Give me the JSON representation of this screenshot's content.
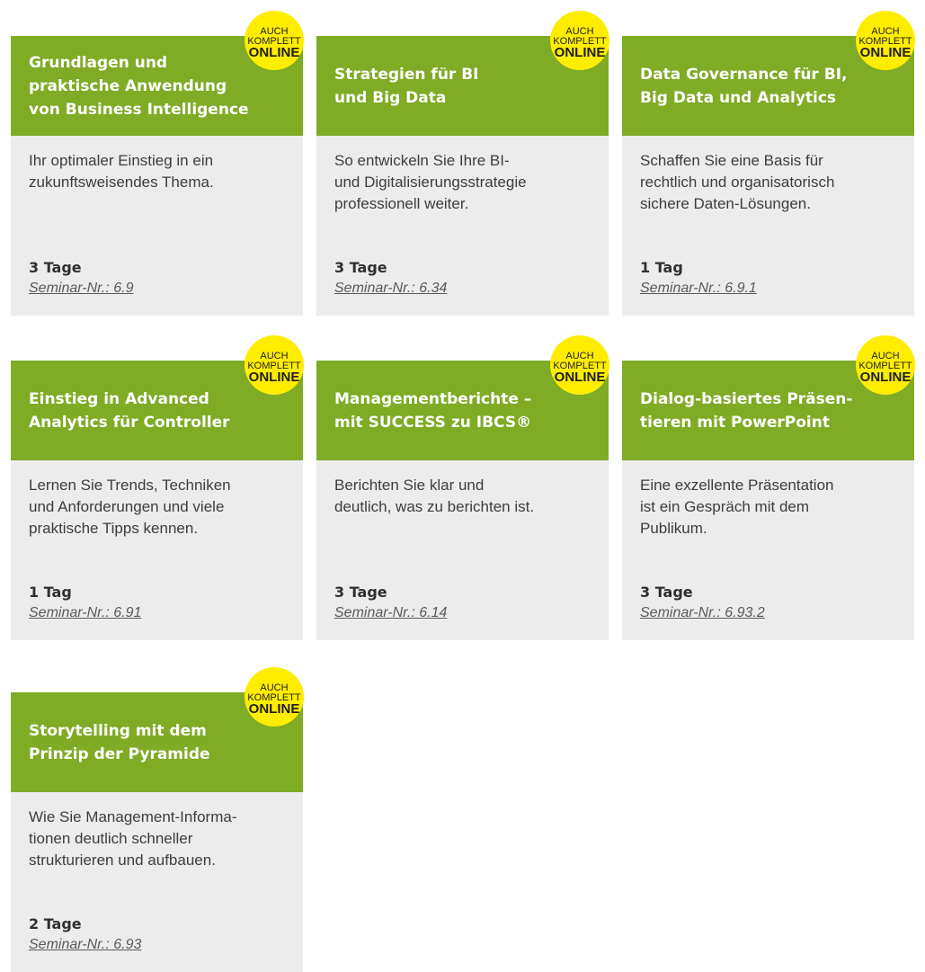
{
  "badge": {
    "line1": "AUCH",
    "line2": "KOMPLETT",
    "line3": "ONLINE"
  },
  "colors": {
    "header_green": "#7fab25",
    "card_gray": "#ececec",
    "badge_yellow": "#ffed00"
  },
  "cards": [
    {
      "title_lines": [
        "Grundlagen und",
        "praktische Anwendung",
        "von Business Intelligence"
      ],
      "desc_lines": [
        "Ihr optimaler Einstieg in ein",
        "zukunftsweisendes Thema."
      ],
      "duration": "3 Tage",
      "seminar": "Seminar-Nr.: 6.9"
    },
    {
      "title_lines": [
        "Strategien für BI",
        "und Big Data"
      ],
      "desc_lines": [
        "So entwickeln Sie Ihre BI-",
        "und Digitalisierungsstrategie",
        "professionell weiter."
      ],
      "duration": "3 Tage",
      "seminar": "Seminar-Nr.: 6.34"
    },
    {
      "title_lines": [
        "Data Governance für BI,",
        "Big Data und Analytics"
      ],
      "desc_lines": [
        "Schaffen Sie eine Basis für",
        "rechtlich und organisatorisch",
        "sichere Daten-Lösungen."
      ],
      "duration": "1 Tag",
      "seminar": "Seminar-Nr.: 6.9.1"
    },
    {
      "title_lines": [
        "Einstieg in Advanced",
        "Analytics für Controller"
      ],
      "desc_lines": [
        "Lernen Sie Trends, Techniken",
        "und Anforderungen und viele",
        "praktische Tipps kennen."
      ],
      "duration": "1 Tag",
      "seminar": "Seminar-Nr.: 6.91"
    },
    {
      "title_lines": [
        "Managementberichte –",
        "mit SUCCESS zu IBCS®"
      ],
      "desc_lines": [
        "Berichten Sie klar und",
        "deutlich, was zu berichten ist."
      ],
      "duration": "3 Tage",
      "seminar": "Seminar-Nr.: 6.14"
    },
    {
      "title_lines": [
        "Dialog-basiertes Präsen-",
        "tieren mit PowerPoint"
      ],
      "desc_lines": [
        "Eine exzellente Präsentation",
        "ist ein Gespräch mit dem",
        "Publikum."
      ],
      "duration": "3 Tage",
      "seminar": "Seminar-Nr.: 6.93.2"
    },
    {
      "title_lines": [
        "Storytelling mit dem",
        "Prinzip der Pyramide"
      ],
      "desc_lines": [
        "Wie Sie Management-Informa-",
        "tionen deutlich schneller",
        "strukturieren und aufbauen."
      ],
      "duration": "2 Tage",
      "seminar": "Seminar-Nr.: 6.93"
    }
  ]
}
